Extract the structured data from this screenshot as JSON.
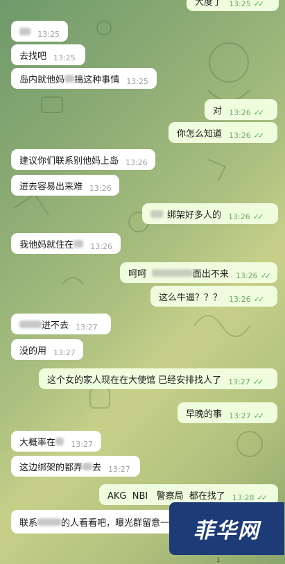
{
  "messages": [
    {
      "id": "m0",
      "side": "out",
      "prefix": "",
      "blur": 0,
      "suffix": "大度了",
      "time": "13:25",
      "status": "read"
    },
    {
      "id": "m1",
      "side": "in",
      "prefix": "",
      "blur": 22,
      "suffix": "",
      "time": "13:25"
    },
    {
      "id": "m2",
      "side": "in",
      "prefix": "去找吧",
      "blur": 0,
      "suffix": "",
      "time": "13:25"
    },
    {
      "id": "m3",
      "side": "in",
      "prefix": "岛内就他妈",
      "blur": 24,
      "suffix": "搞这种事情",
      "time": "13:25"
    },
    {
      "id": "m4",
      "side": "out",
      "prefix": "对",
      "blur": 0,
      "suffix": "",
      "time": "13:26",
      "status": "read"
    },
    {
      "id": "m5",
      "side": "out",
      "prefix": "你怎么知道",
      "blur": 0,
      "suffix": "",
      "time": "13:26",
      "status": "read"
    },
    {
      "id": "m6",
      "side": "in",
      "prefix": "建议你们联系别他妈上岛",
      "blur": 0,
      "suffix": "",
      "time": "13:26"
    },
    {
      "id": "m7",
      "side": "in",
      "prefix": "进去容易出来难",
      "blur": 0,
      "suffix": "",
      "time": "13:26"
    },
    {
      "id": "m8",
      "side": "out",
      "prefix": "",
      "blur": 18,
      "suffix": "绑架好多人的",
      "time": "13:26",
      "status": "read"
    },
    {
      "id": "m9",
      "side": "in",
      "prefix": "我他妈就住在",
      "blur": 26,
      "suffix": "",
      "time": "13:26"
    },
    {
      "id": "m10",
      "side": "out",
      "prefix": "呵呵",
      "blur": 70,
      "suffix": "面出不来",
      "time": "13:26",
      "status": "read"
    },
    {
      "id": "m11",
      "side": "out",
      "prefix": "这么牛逼？？？",
      "blur": 0,
      "suffix": "",
      "time": "13:26",
      "status": "read"
    },
    {
      "id": "m12",
      "side": "in",
      "prefix": "",
      "blur": 32,
      "suffix": "进不去",
      "time": "13:27"
    },
    {
      "id": "m13",
      "side": "in",
      "prefix": "没的用",
      "blur": 0,
      "suffix": "",
      "time": "13:27"
    },
    {
      "id": "m14",
      "side": "out",
      "prefix": "这个女的家人现在在大使馆 已经安排找人了",
      "blur": 0,
      "suffix": "",
      "time": "13:27",
      "status": "read"
    },
    {
      "id": "m15",
      "side": "out",
      "prefix": "早晚的事",
      "blur": 0,
      "suffix": "",
      "time": "13:27",
      "status": "read"
    },
    {
      "id": "m16",
      "side": "in",
      "prefix": "大概率在",
      "blur": 22,
      "suffix": "",
      "time": "13:27"
    },
    {
      "id": "m17",
      "side": "in",
      "prefix": "这边绑架的都弄",
      "blur": 14,
      "suffix": "去",
      "time": "13:27"
    },
    {
      "id": "m18",
      "side": "out",
      "prefix": "AKG  NBI   警察局  都在找了",
      "blur": 0,
      "suffix": "",
      "time": "13:28",
      "status": "read"
    },
    {
      "id": "m19",
      "side": "in",
      "prefix": "联系",
      "blur": 40,
      "suffix": "的人看看吧，曝光群留意一下",
      "blur2": 0,
      "time": ""
    }
  ],
  "status_icons": {
    "read": "double-check-icon"
  },
  "watermark": {
    "text": "菲华网",
    "bg": "#1c3b77"
  },
  "scroll_indicator": {
    "text": "1"
  },
  "colors": {
    "incoming": "#ffffff",
    "outgoing": "#effdde",
    "check": "#57ad54",
    "time_in": "#9aa0a6",
    "time_out": "#6fa66a"
  }
}
